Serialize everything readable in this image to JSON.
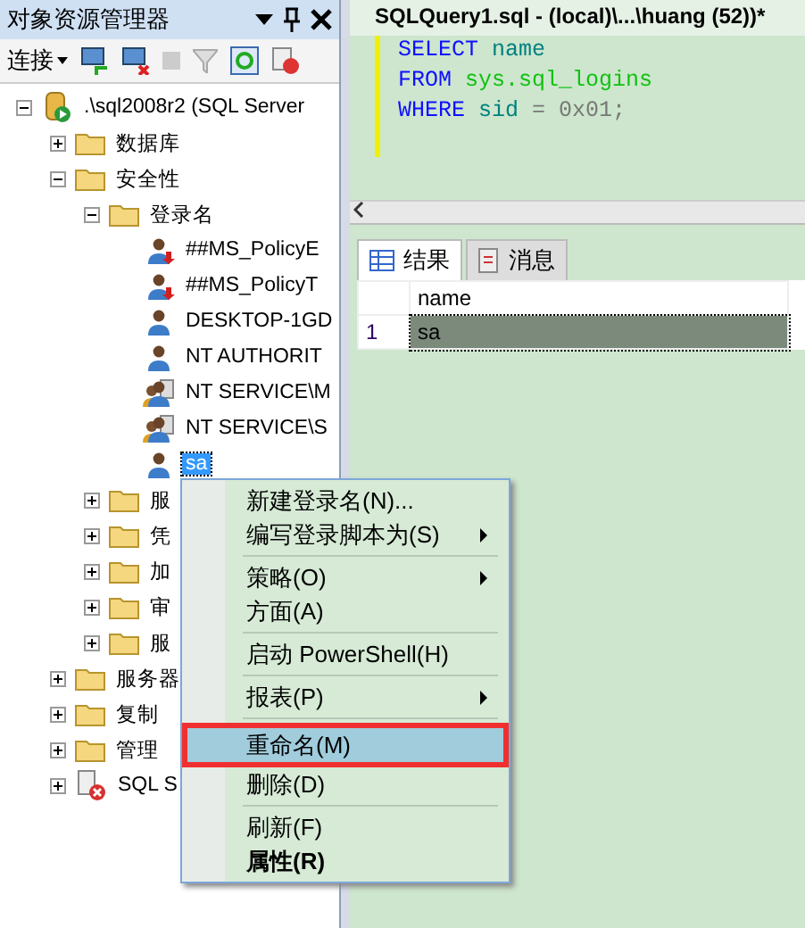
{
  "explorer": {
    "title": "对象资源管理器",
    "toolbar": {
      "connect": "连接"
    },
    "tree": [
      {
        "label": ".\\sql2008r2 (SQL Server",
        "kind": "server",
        "expanded": true,
        "selected": false,
        "children": [
          {
            "label": "数据库",
            "kind": "folder",
            "expanded": false,
            "selected": false
          },
          {
            "label": "安全性",
            "kind": "folder",
            "expanded": true,
            "selected": false,
            "children": [
              {
                "label": "登录名",
                "kind": "folder",
                "expanded": true,
                "selected": false,
                "children": [
                  {
                    "label": "##MS_PolicyE",
                    "kind": "cert-login",
                    "selected": false
                  },
                  {
                    "label": "##MS_PolicyT",
                    "kind": "cert-login",
                    "selected": false
                  },
                  {
                    "label": "DESKTOP-1GD",
                    "kind": "login",
                    "selected": false
                  },
                  {
                    "label": "NT AUTHORIT",
                    "kind": "login",
                    "selected": false
                  },
                  {
                    "label": "NT SERVICE\\M",
                    "kind": "group-login",
                    "selected": false
                  },
                  {
                    "label": "NT SERVICE\\S",
                    "kind": "group-login",
                    "selected": false
                  },
                  {
                    "label": "sa",
                    "kind": "login",
                    "selected": true
                  }
                ]
              },
              {
                "label": "服",
                "kind": "folder",
                "expanded": false,
                "selected": false
              },
              {
                "label": "凭",
                "kind": "folder",
                "expanded": false,
                "selected": false
              },
              {
                "label": "加",
                "kind": "folder",
                "expanded": false,
                "selected": false
              },
              {
                "label": "审",
                "kind": "folder",
                "expanded": false,
                "selected": false
              },
              {
                "label": "服",
                "kind": "folder",
                "expanded": false,
                "selected": false
              }
            ]
          },
          {
            "label": "服务器",
            "kind": "folder",
            "expanded": false,
            "selected": false
          },
          {
            "label": "复制",
            "kind": "folder",
            "expanded": false,
            "selected": false
          },
          {
            "label": "管理",
            "kind": "folder",
            "expanded": false,
            "selected": false
          },
          {
            "label": "SQL S",
            "kind": "agent",
            "expanded": false,
            "selected": false
          }
        ]
      }
    ]
  },
  "query": {
    "title": "SQLQuery1.sql - (local)\\...\\huang (52))*",
    "lines": [
      [
        {
          "t": "SELECT",
          "kind": "keyword"
        },
        {
          "t": " name",
          "kind": "identifier"
        }
      ],
      [
        {
          "t": "FROM",
          "kind": "keyword"
        },
        {
          "t": " sys.sql_logins",
          "kind": "system"
        }
      ],
      [
        {
          "t": "WHERE",
          "kind": "keyword"
        },
        {
          "t": " sid",
          "kind": "identifier"
        },
        {
          "t": " = 0x01;",
          "kind": "operator"
        }
      ]
    ]
  },
  "results": {
    "tabs": [
      {
        "label": "结果",
        "selected": true
      },
      {
        "label": "消息",
        "selected": false
      }
    ],
    "columns": [
      "name"
    ],
    "rows": [
      {
        "number": "1",
        "cells": [
          "sa"
        ],
        "selected": true
      }
    ]
  },
  "context_menu": [
    {
      "kind": "item",
      "label": "新建登录名(N)...",
      "submenu": false,
      "highlighted": false,
      "annotated": false,
      "bold": false
    },
    {
      "kind": "item",
      "label": "编写登录脚本为(S)",
      "submenu": true,
      "highlighted": false,
      "annotated": false,
      "bold": false
    },
    {
      "kind": "separator"
    },
    {
      "kind": "item",
      "label": "策略(O)",
      "submenu": true,
      "highlighted": false,
      "annotated": false,
      "bold": false
    },
    {
      "kind": "item",
      "label": "方面(A)",
      "submenu": false,
      "highlighted": false,
      "annotated": false,
      "bold": false
    },
    {
      "kind": "separator"
    },
    {
      "kind": "item",
      "label": "启动 PowerShell(H)",
      "submenu": false,
      "highlighted": false,
      "annotated": false,
      "bold": false
    },
    {
      "kind": "separator"
    },
    {
      "kind": "item",
      "label": "报表(P)",
      "submenu": true,
      "highlighted": false,
      "annotated": false,
      "bold": false
    },
    {
      "kind": "separator"
    },
    {
      "kind": "item",
      "label": "重命名(M)",
      "submenu": false,
      "highlighted": true,
      "annotated": true,
      "bold": false
    },
    {
      "kind": "item",
      "label": "删除(D)",
      "submenu": false,
      "highlighted": false,
      "annotated": false,
      "bold": false
    },
    {
      "kind": "separator"
    },
    {
      "kind": "item",
      "label": "刷新(F)",
      "submenu": false,
      "highlighted": false,
      "annotated": false,
      "bold": false
    },
    {
      "kind": "item",
      "label": "属性(R)",
      "submenu": false,
      "highlighted": false,
      "annotated": false,
      "bold": true
    }
  ]
}
